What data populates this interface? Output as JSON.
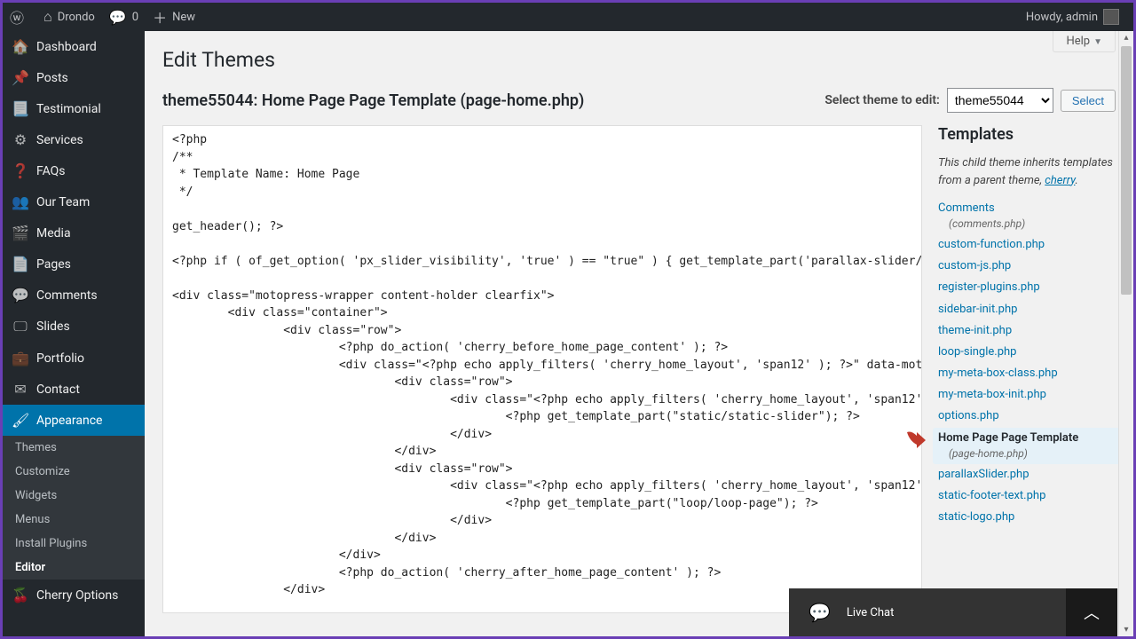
{
  "adminbar": {
    "site_name": "Drondo",
    "comments_count": "0",
    "new": "New",
    "howdy": "Howdy, admin"
  },
  "sidebar": {
    "items": [
      {
        "icon": "🏠",
        "label": "Dashboard"
      },
      {
        "icon": "📌",
        "label": "Posts"
      },
      {
        "icon": "📃",
        "label": "Testimonial"
      },
      {
        "icon": "⚙",
        "label": "Services"
      },
      {
        "icon": "❓",
        "label": "FAQs"
      },
      {
        "icon": "👥",
        "label": "Our Team"
      },
      {
        "icon": "🎬",
        "label": "Media"
      },
      {
        "icon": "📄",
        "label": "Pages"
      },
      {
        "icon": "💬",
        "label": "Comments"
      },
      {
        "icon": "🖵",
        "label": "Slides"
      },
      {
        "icon": "💼",
        "label": "Portfolio"
      },
      {
        "icon": "✉",
        "label": "Contact"
      },
      {
        "icon": "🖌",
        "label": "Appearance",
        "current": true
      },
      {
        "icon": "🍒",
        "label": "Cherry Options"
      }
    ],
    "submenu": [
      {
        "label": "Themes"
      },
      {
        "label": "Customize"
      },
      {
        "label": "Widgets"
      },
      {
        "label": "Menus"
      },
      {
        "label": "Install Plugins"
      },
      {
        "label": "Editor",
        "current": true
      }
    ]
  },
  "page": {
    "title": "Edit Themes",
    "help": "Help",
    "file_heading": "theme55044: Home Page Page Template (page-home.php)",
    "select_label": "Select theme to edit:",
    "selected_theme": "theme55044",
    "select_button": "Select"
  },
  "editor": {
    "content": "<?php\n/**\n * Template Name: Home Page\n */\n\nget_header(); ?>\n\n<?php if ( of_get_option( 'px_slider_visibility', 'true' ) == \"true\" ) { get_template_part('parallax-slider/parallaxSlider'); } ?>\n\n<div class=\"motopress-wrapper content-holder clearfix\">\n        <div class=\"container\">\n                <div class=\"row\">\n                        <?php do_action( 'cherry_before_home_page_content' ); ?>\n                        <div class=\"<?php echo apply_filters( 'cherry_home_layout', 'span12' ); ?>\" data-motopress-wrapper-file=\"page-home.php\" data-motopress-wrapper-type=\"content\">\n                                <div class=\"row\">\n                                        <div class=\"<?php echo apply_filters( 'cherry_home_layout', 'span12' ); ?>\" data-motopress-type=\"static\" data-motopress-static-file=\"static/static-slider.php\">\n                                                <?php get_template_part(\"static/static-slider\"); ?>\n                                        </div>\n                                </div>\n                                <div class=\"row\">\n                                        <div class=\"<?php echo apply_filters( 'cherry_home_layout', 'span12' ); ?>\" data-motopress-type=\"loop\" data-motopress-loop-file=\"loop/loop-page.php\">\n                                                <?php get_template_part(\"loop/loop-page\"); ?>\n                                        </div>\n                                </div>\n                        </div>\n                        <?php do_action( 'cherry_after_home_page_content' ); ?>\n                </div>\n"
  },
  "files": {
    "heading": "Templates",
    "inherit_note_pre": "This child theme inherits templates from a parent theme, ",
    "inherit_link": "cherry",
    "list": [
      {
        "label": "Comments",
        "sub": "(comments.php)"
      },
      {
        "label": "custom-function.php"
      },
      {
        "label": "custom-js.php"
      },
      {
        "label": "register-plugins.php"
      },
      {
        "label": "sidebar-init.php"
      },
      {
        "label": "theme-init.php"
      },
      {
        "label": "loop-single.php"
      },
      {
        "label": "my-meta-box-class.php"
      },
      {
        "label": "my-meta-box-init.php"
      },
      {
        "label": "options.php"
      },
      {
        "label": "Home Page Page Template",
        "sub": "(page-home.php)",
        "active": true
      },
      {
        "label": "parallaxSlider.php"
      },
      {
        "label": "static-footer-text.php"
      },
      {
        "label": "static-logo.php"
      }
    ]
  },
  "chat": {
    "label": "Live Chat"
  }
}
